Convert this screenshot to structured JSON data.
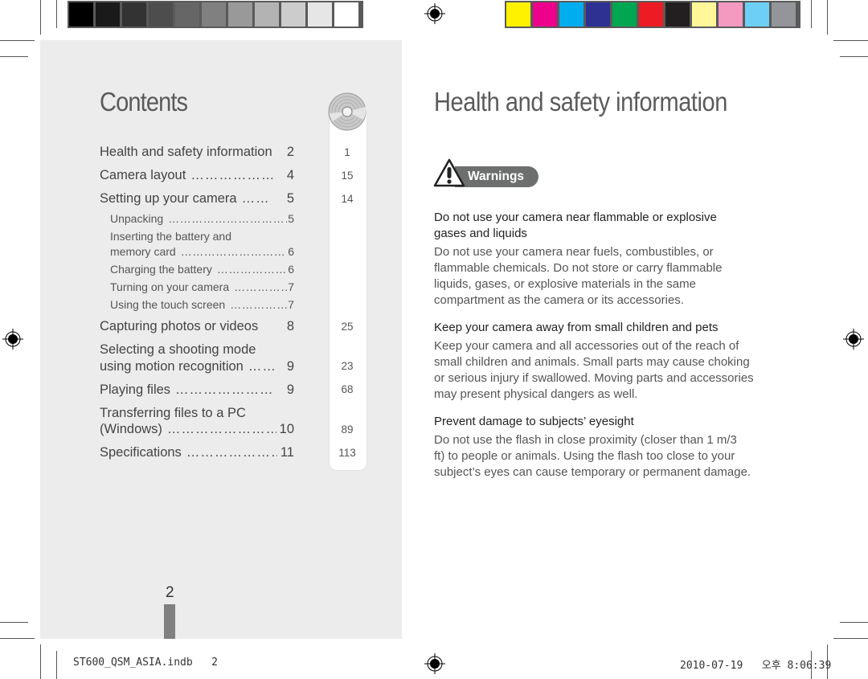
{
  "print_marks": {
    "grayscale_swatches": [
      "#000000",
      "#1a1a1a",
      "#333333",
      "#4d4d4d",
      "#666666",
      "#808080",
      "#999999",
      "#b3b3b3",
      "#cccccc",
      "#e6e6e6",
      "#ffffff"
    ],
    "color_swatches": [
      "#fff200",
      "#ec008c",
      "#00aeef",
      "#2e3192",
      "#00a651",
      "#ed1c24",
      "#231f20",
      "#fff799",
      "#f49ac1",
      "#6dcff6",
      "#939598"
    ]
  },
  "contents": {
    "title": "Contents",
    "entries": [
      {
        "label": "Health and safety information",
        "dots": "",
        "page": "2",
        "ref": "1"
      },
      {
        "label": "Camera layout",
        "dots": "………………",
        "page": "4",
        "ref": "15"
      },
      {
        "label": "Setting up your camera",
        "dots": "……",
        "page": "5",
        "ref": "14"
      },
      {
        "label": "Capturing photos or videos",
        "dots": "",
        "page": "8",
        "ref": "25"
      },
      {
        "label_line1": "Selecting a shooting mode",
        "label": "using motion recognition",
        "dots": "……",
        "page": "9",
        "ref": "23"
      },
      {
        "label": "Playing files",
        "dots": "…………………",
        "page": "9",
        "ref": "68"
      },
      {
        "label_line1": "Transferring files to a PC",
        "label": "(Windows)",
        "dots": "……………………………",
        "page": "10",
        "ref": "89"
      },
      {
        "label": "Specifications",
        "dots": "……………………",
        "page": "11",
        "ref": "113"
      }
    ],
    "sub_entries": [
      {
        "label": "Unpacking",
        "dots": "……………………………………",
        "page": "5"
      },
      {
        "label_line1": "Inserting the battery and",
        "label": "memory card",
        "dots": "……………………………",
        "page": "6"
      },
      {
        "label": "Charging the battery",
        "dots": "……………………",
        "page": "6"
      },
      {
        "label": "Turning on your camera",
        "dots": "…………………",
        "page": "7"
      },
      {
        "label": "Using the touch screen",
        "dots": "…………………",
        "page": "7"
      }
    ],
    "page_number": "2"
  },
  "health": {
    "title": "Health and safety information",
    "badge": "Warnings",
    "sections": [
      {
        "heading_line1": "Do not use your camera near flammable or explosive",
        "heading_line2": "gases and liquids",
        "body": [
          "Do not use your camera near fuels, combustibles, or",
          "flammable chemicals. Do not store or carry flammable",
          "liquids, gases, or explosive materials in the same",
          "compartment as the camera or its accessories."
        ]
      },
      {
        "heading_line1": "Keep your camera away from small children and pets",
        "body": [
          "Keep your camera and all accessories out of the reach of",
          "small children and animals. Small parts may cause choking",
          "or serious injury if swallowed. Moving parts and accessories",
          "may present physical dangers as well."
        ]
      },
      {
        "heading_line1": "Prevent damage to subjects’ eyesight",
        "body": [
          "Do not use the flash in close proximity (closer than 1 m/3",
          "ft) to people or animals. Using the flash too close to your",
          "subject’s eyes can cause temporary or permanent damage."
        ]
      }
    ]
  },
  "slug": {
    "filename": "ST600_QSM_ASIA.indb   2",
    "timestamp": "2010-07-19   오후 8:06:39"
  }
}
